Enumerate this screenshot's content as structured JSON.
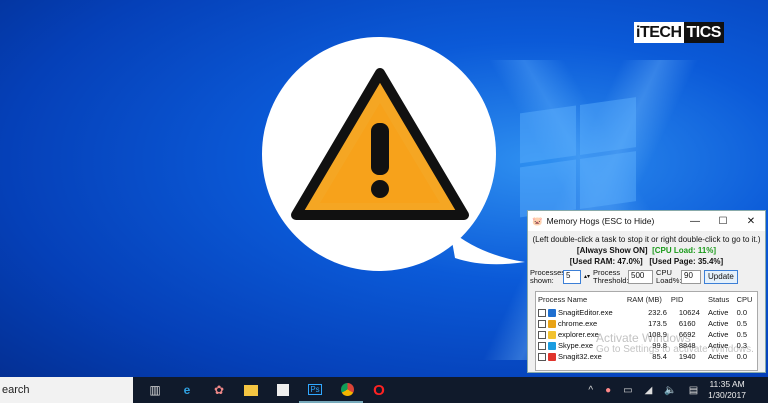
{
  "logo": {
    "part1": "iTECH",
    "part2": "TICS"
  },
  "warning_icon": "warning-triangle-icon",
  "window": {
    "title": "Memory Hogs (ESC to Hide)",
    "hint": "(Left double-click a task to stop it or right double-click to go to it.)",
    "always_show": "[Always Show ON]",
    "cpu_load": "[CPU Load: 11%]",
    "used_ram": "[Used RAM: 47.0%]",
    "used_page": "[Used Page: 35.4%]",
    "processes_shown_label": "Processes shown:",
    "processes_shown_value": "5",
    "threshold_label": "Process Threshold:",
    "threshold_value": "500",
    "cpu_label": "CPU Load%:",
    "cpu_value": "90",
    "update_label": "Update",
    "columns": [
      "Process Name",
      "RAM (MB)",
      "PID",
      "Status",
      "CPU"
    ],
    "rows": [
      {
        "name": "SnagitEditor.exe",
        "ram": "232.6",
        "pid": "10624",
        "status": "Active",
        "cpu": "0.0",
        "color": "#1e6fd0"
      },
      {
        "name": "chrome.exe",
        "ram": "173.5",
        "pid": "6160",
        "status": "Active",
        "cpu": "0.5",
        "color": "#e8a317"
      },
      {
        "name": "explorer.exe",
        "ram": "108.9",
        "pid": "6692",
        "status": "Active",
        "cpu": "0.5",
        "color": "#f2c230"
      },
      {
        "name": "Skype.exe",
        "ram": "99.8",
        "pid": "8848",
        "status": "Active",
        "cpu": "0.3",
        "color": "#1a9ce0"
      },
      {
        "name": "Snagit32.exe",
        "ram": "85.4",
        "pid": "1940",
        "status": "Active",
        "cpu": "0.0",
        "color": "#e0342c"
      }
    ],
    "watermark1": "Activate Windows",
    "watermark2": "Go to Settings to activate Windows."
  },
  "taskbar": {
    "search": "earch",
    "time": "11:35 AM",
    "date": "1/30/2017"
  }
}
